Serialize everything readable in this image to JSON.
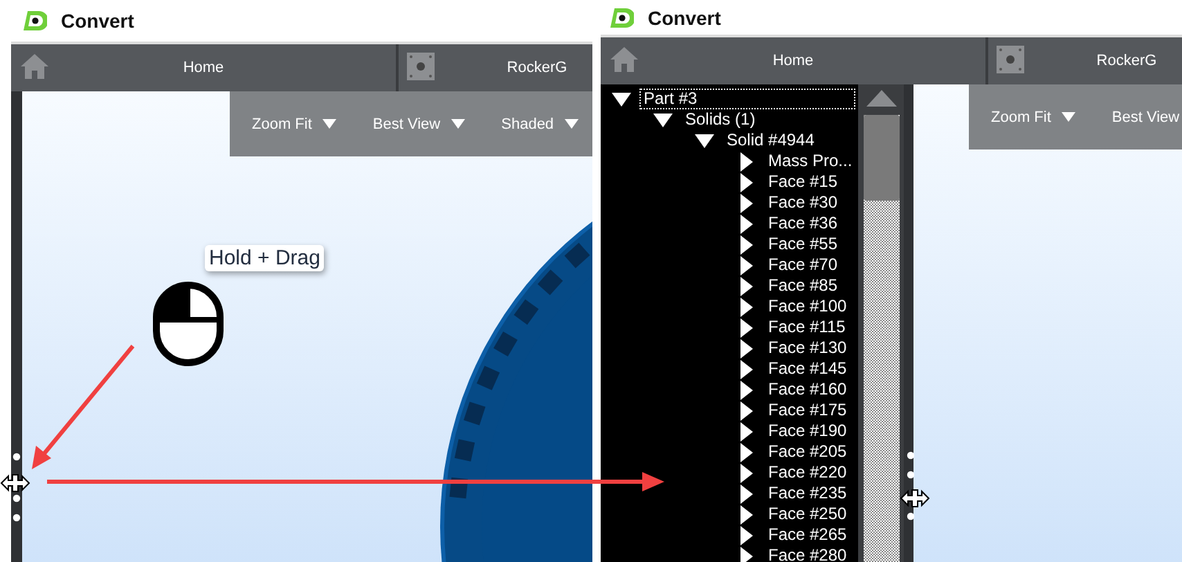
{
  "windows": [
    {
      "title": "Convert",
      "tabs": [
        {
          "label": "Home",
          "kind": "home"
        },
        {
          "label": "RockerG",
          "kind": "part"
        }
      ],
      "toolbar": [
        {
          "label": "Zoom Fit"
        },
        {
          "label": "Best View"
        },
        {
          "label": "Shaded"
        }
      ],
      "viewport": {
        "kind": "picture"
      },
      "callout": "Hold + Drag"
    },
    {
      "title": "Convert",
      "tabs": [
        {
          "label": "Home",
          "kind": "home"
        },
        {
          "label": "RockerG",
          "kind": "part"
        }
      ],
      "toolbar": [
        {
          "label": "Zoom Fit"
        },
        {
          "label": "Best View",
          "cut": true
        }
      ],
      "tree": [
        {
          "label": "Part #3",
          "expanded": true,
          "selected": true,
          "children": [
            {
              "label": "Solids (1)",
              "expanded": true,
              "selected": false,
              "children": [
                {
                  "label": "Solid #4944",
                  "expanded": true,
                  "selected": false,
                  "children": [
                    {
                      "label": "Mass Pro...",
                      "expanded": false,
                      "selected": false
                    },
                    {
                      "label": "Face #15",
                      "expanded": false,
                      "selected": false
                    },
                    {
                      "label": "Face #30",
                      "expanded": false,
                      "selected": false
                    },
                    {
                      "label": "Face #36",
                      "expanded": false,
                      "selected": false
                    },
                    {
                      "label": "Face #55",
                      "expanded": false,
                      "selected": false
                    },
                    {
                      "label": "Face #70",
                      "expanded": false,
                      "selected": false
                    },
                    {
                      "label": "Face #85",
                      "expanded": false,
                      "selected": false
                    },
                    {
                      "label": "Face #100",
                      "expanded": false,
                      "selected": false
                    },
                    {
                      "label": "Face #115",
                      "expanded": false,
                      "selected": false
                    },
                    {
                      "label": "Face #130",
                      "expanded": false,
                      "selected": false
                    },
                    {
                      "label": "Face #145",
                      "expanded": false,
                      "selected": false
                    },
                    {
                      "label": "Face #160",
                      "expanded": false,
                      "selected": false
                    },
                    {
                      "label": "Face #175",
                      "expanded": false,
                      "selected": false
                    },
                    {
                      "label": "Face #190",
                      "expanded": false,
                      "selected": false
                    },
                    {
                      "label": "Face #205",
                      "expanded": false,
                      "selected": false
                    },
                    {
                      "label": "Face #220",
                      "expanded": false,
                      "selected": false
                    },
                    {
                      "label": "Face #235",
                      "expanded": false,
                      "selected": false
                    },
                    {
                      "label": "Face #250",
                      "expanded": false,
                      "selected": false
                    },
                    {
                      "label": "Face #265",
                      "expanded": false,
                      "selected": false
                    },
                    {
                      "label": "Face #280",
                      "expanded": false,
                      "selected": false
                    }
                  ]
                }
              ]
            }
          ]
        }
      ]
    }
  ]
}
